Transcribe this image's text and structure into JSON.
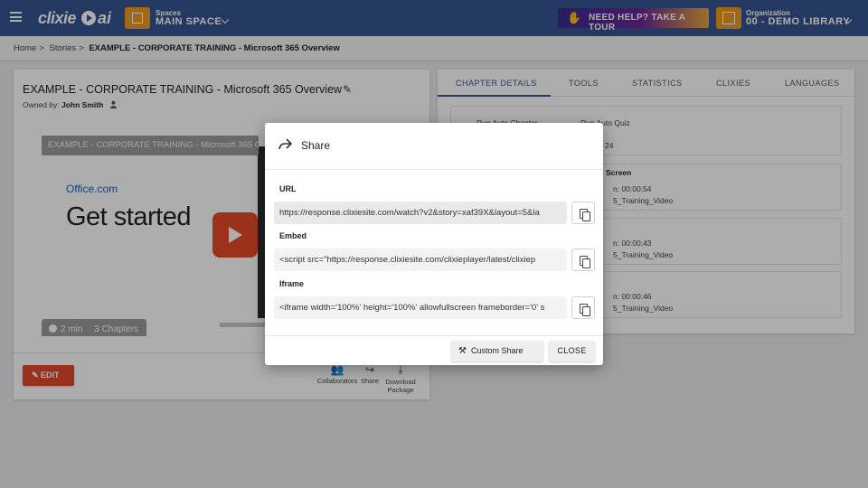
{
  "header": {
    "logo_text": "clixie",
    "logo_suffix": "ai",
    "spaces_label": "Spaces",
    "spaces_value": "MAIN SPACE",
    "help_label": "NEED HELP? TAKE A TOUR",
    "org_label": "Organization",
    "org_value": "00 - DEMO LIBRARY"
  },
  "breadcrumb": {
    "home": "Home",
    "stories": "Stories",
    "current": "EXAMPLE - CORPORATE TRAINING - Microsoft 365 Overview"
  },
  "story": {
    "title": "EXAMPLE - CORPORATE TRAINING - Microsoft 365 Overview",
    "owned_prefix": "Owned by:",
    "owner": "John Smith",
    "video_title": "EXAMPLE - CORPORATE TRAINING - Microsoft 365 Overview",
    "video_brand": "Office.com",
    "video_headline": "Get started",
    "duration": "2 min",
    "chapters": "3 Chapters",
    "edit_label": "EDIT",
    "actions": {
      "collaborators": "Collaborators",
      "share": "Share",
      "download": "Download",
      "download_sub": "Package"
    }
  },
  "tabs": [
    "CHAPTER DETAILS",
    "TOOLS",
    "STATISTICS",
    "CLIXIES",
    "LANGUAGES"
  ],
  "chapter_panel": {
    "run_auto_chapter": "Run Auto Chapter",
    "run_auto_quiz": "Run Auto Quiz",
    "count_frag": "24",
    "row1_title_frag": "Screen",
    "row1_time_frag": "n: 00:00:54",
    "row1_src_frag": "5_Training_Video",
    "row2_time_frag": "n: 00:00:43",
    "row2_src_frag": "5_Training_Video",
    "row3_time_frag": "n: 00:00:46",
    "row3_src_frag": "5_Training_Video"
  },
  "modal": {
    "title": "Share",
    "url_label": "URL",
    "url_value": "https://response.clixiesite.com/watch?v2&story=xaf39X&layout=5&la",
    "embed_label": "Embed",
    "embed_value": "<script src=\"https://response.clixiesite.com/clixieplayer/latest/clixiep",
    "iframe_label": "Iframe",
    "iframe_value": "<iframe  width='100%' height='100%' allowfullscreen frameborder='0' s",
    "custom_share": "Custom Share",
    "close": "CLOSE"
  }
}
